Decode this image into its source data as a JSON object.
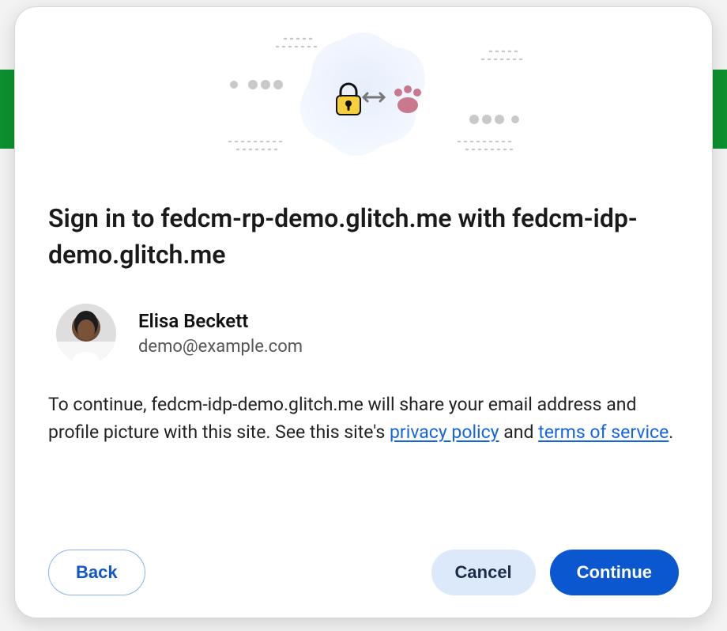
{
  "dialog": {
    "title": "Sign in to fedcm-rp-demo.glitch.me with fedcm-idp-demo.glitch.me",
    "account": {
      "name": "Elisa Beckett",
      "email": "demo@example.com"
    },
    "consent": {
      "prefix": "To continue, fedcm-idp-demo.glitch.me will share your email address and profile picture with this site. See this site's ",
      "privacy_label": "privacy policy",
      "joiner": " and ",
      "tos_label": "terms of service",
      "suffix": "."
    },
    "buttons": {
      "back": "Back",
      "cancel": "Cancel",
      "continue": "Continue"
    }
  }
}
